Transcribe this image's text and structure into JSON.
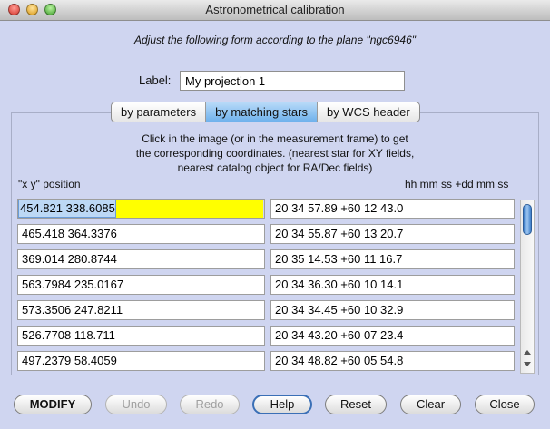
{
  "window": {
    "title": "Astronometrical calibration"
  },
  "instruction": "Adjust the following form according to the plane \"ngc6946\"",
  "label": {
    "caption": "Label:",
    "value": "My projection 1"
  },
  "tabs": [
    {
      "label": "by parameters",
      "active": false
    },
    {
      "label": "by matching stars",
      "active": true
    },
    {
      "label": "by WCS header",
      "active": false
    }
  ],
  "help": {
    "line1": "Click in the image (or in the measurement frame) to get",
    "line2": "the corresponding coordinates. (nearest star for XY fields,",
    "line3": "nearest catalog object for RA/Dec fields)"
  },
  "columns": {
    "xy": "\"x y\" position",
    "radec": "hh mm ss +dd mm ss"
  },
  "rows": [
    {
      "xy": "454.821 338.6085",
      "radec": "20 34 57.89 +60 12 43.0",
      "selected": true
    },
    {
      "xy": "465.418 364.3376",
      "radec": "20 34 55.87 +60 13 20.7"
    },
    {
      "xy": "369.014 280.8744",
      "radec": "20 35 14.53 +60 11 16.7"
    },
    {
      "xy": "563.7984 235.0167",
      "radec": "20 34 36.30 +60 10 14.1"
    },
    {
      "xy": "573.3506 247.8211",
      "radec": "20 34 34.45 +60 10 32.9"
    },
    {
      "xy": "526.7708 118.711",
      "radec": "20 34 43.20 +60 07 23.4"
    },
    {
      "xy": "497.2379 58.4059",
      "radec": "20 34 48.82 +60 05 54.8"
    }
  ],
  "buttons": {
    "modify": "MODIFY",
    "undo": "Undo",
    "redo": "Redo",
    "help": "Help",
    "reset": "Reset",
    "clear": "Clear",
    "close": "Close"
  },
  "colors": {
    "selection_highlight": "#ffff00",
    "active_tab": "#6fb1ec",
    "window_bg": "#cfd5f0"
  }
}
